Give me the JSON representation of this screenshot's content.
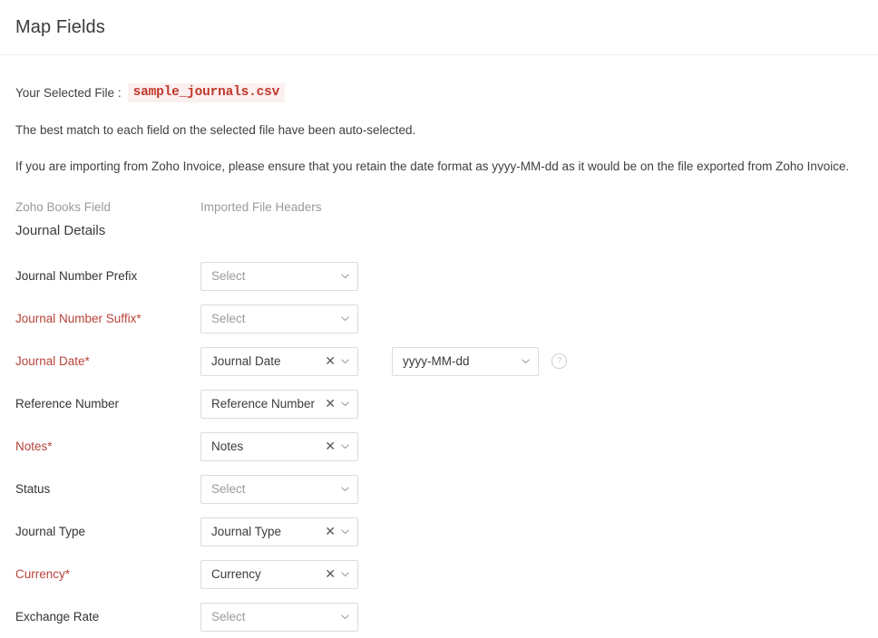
{
  "header": {
    "title": "Map Fields"
  },
  "intro": {
    "file_label": "Your Selected File :",
    "file_name": "sample_journals.csv",
    "line1": "The best match to each field on the selected file have been auto-selected.",
    "line2": "If you are importing from Zoho Invoice, please ensure that you retain the date format as yyyy-MM-dd as it would be on the file exported from Zoho Invoice."
  },
  "columns": {
    "left": "Zoho Books Field",
    "right": "Imported File Headers"
  },
  "section": {
    "title": "Journal Details"
  },
  "placeholder": "Select",
  "icons": {
    "clear": "✕",
    "help": "?"
  },
  "colors": {
    "required": "#b8433a",
    "file_badge_text": "#c0392b",
    "file_badge_bg": "#fbeff0",
    "border": "#dcdcdc",
    "placeholder_text": "#9b9b9b"
  },
  "rows": [
    {
      "label": "Journal Number Prefix",
      "required": false,
      "value": "Select",
      "is_placeholder": true,
      "clearable": false
    },
    {
      "label": "Journal Number Suffix",
      "required": true,
      "value": "Select",
      "is_placeholder": true,
      "clearable": false
    },
    {
      "label": "Journal Date",
      "required": true,
      "value": "Journal Date",
      "is_placeholder": false,
      "clearable": true,
      "date_format": "yyyy-MM-dd",
      "has_help": true
    },
    {
      "label": "Reference Number",
      "required": false,
      "value": "Reference Number",
      "is_placeholder": false,
      "clearable": true
    },
    {
      "label": "Notes",
      "required": true,
      "value": "Notes",
      "is_placeholder": false,
      "clearable": true
    },
    {
      "label": "Status",
      "required": false,
      "value": "Select",
      "is_placeholder": true,
      "clearable": false
    },
    {
      "label": "Journal Type",
      "required": false,
      "value": "Journal Type",
      "is_placeholder": false,
      "clearable": true
    },
    {
      "label": "Currency",
      "required": true,
      "value": "Currency",
      "is_placeholder": false,
      "clearable": true
    },
    {
      "label": "Exchange Rate",
      "required": false,
      "value": "Select",
      "is_placeholder": true,
      "clearable": false
    }
  ]
}
